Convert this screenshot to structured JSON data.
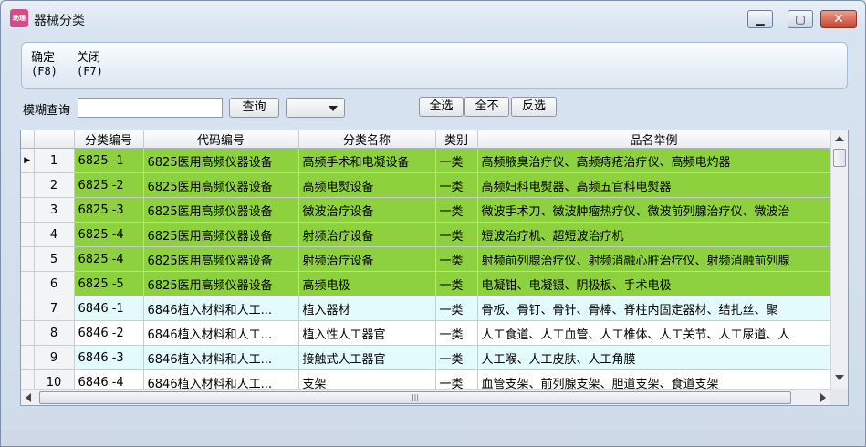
{
  "window": {
    "title": "器械分类",
    "app_icon_text": "助理"
  },
  "toolbar": {
    "confirm": {
      "label": "确定",
      "key": "(F8)"
    },
    "close": {
      "label": "关闭",
      "key": "(F7)"
    }
  },
  "search": {
    "label": "模糊查询",
    "value": "",
    "query_button": "查询",
    "dropdown_value": ""
  },
  "selection": {
    "select_all": "全选",
    "select_none": "全不",
    "invert": "反选"
  },
  "table": {
    "columns": [
      "分类编号",
      "代码编号",
      "分类名称",
      "类别",
      "品名举例"
    ],
    "rows": [
      {
        "n": "1",
        "code": "6825 -1",
        "dcode": "6825医用高频仪器设备",
        "name": "高频手术和电凝设备",
        "cls": "一类",
        "ex": "高频腋臭治疗仪、高频痔疮治疗仪、高频电灼器",
        "style": "green",
        "cur": true
      },
      {
        "n": "2",
        "code": "6825 -2",
        "dcode": "6825医用高频仪器设备",
        "name": "高频电熨设备",
        "cls": "一类",
        "ex": "高频妇科电熨器、高频五官科电熨器",
        "style": "green",
        "cur": false
      },
      {
        "n": "3",
        "code": "6825 -3",
        "dcode": "6825医用高频仪器设备",
        "name": "微波治疗设备",
        "cls": "一类",
        "ex": "微波手术刀、微波肿瘤热疗仪、微波前列腺治疗仪、微波治",
        "style": "green",
        "cur": false
      },
      {
        "n": "4",
        "code": "6825 -4",
        "dcode": "6825医用高频仪器设备",
        "name": "射频治疗设备",
        "cls": "一类",
        "ex": "短波治疗机、超短波治疗机",
        "style": "green",
        "cur": false
      },
      {
        "n": "5",
        "code": "6825 -4",
        "dcode": "6825医用高频仪器设备",
        "name": "射频治疗设备",
        "cls": "一类",
        "ex": "射频前列腺治疗仪、射频消融心脏治疗仪、射频消融前列腺",
        "style": "green",
        "cur": false
      },
      {
        "n": "6",
        "code": "6825 -5",
        "dcode": "6825医用高频仪器设备",
        "name": "高频电极",
        "cls": "一类",
        "ex": " 电凝钳、电凝镊、阴极板、手术电极",
        "style": "green",
        "cur": false
      },
      {
        "n": "7",
        "code": "6846 -1",
        "dcode": "6846植入材料和人工...",
        "name": "植入器材",
        "cls": "一类",
        "ex": "骨板、骨钉、骨针、骨棒、脊柱内固定器材、结扎丝、聚",
        "style": "cyan",
        "cur": false
      },
      {
        "n": "8",
        "code": "6846 -2",
        "dcode": "6846植入材料和人工...",
        "name": "植入性人工器官",
        "cls": "一类",
        "ex": "人工食道、人工血管、人工椎体、人工关节、人工尿道、人",
        "style": "white",
        "cur": false
      },
      {
        "n": "9",
        "code": "6846 -3",
        "dcode": "6846植入材料和人工...",
        "name": "接触式人工器官",
        "cls": "一类",
        "ex": "人工喉、人工皮肤、人工角膜",
        "style": "cyan",
        "cur": false
      },
      {
        "n": "10",
        "code": "6846 -4",
        "dcode": "6846植入材料和人工...",
        "name": "支架",
        "cls": "一类",
        "ex": "血管支架、前列腺支架、胆道支架、食道支架",
        "style": "white",
        "cur": false
      }
    ]
  },
  "icons": {
    "minimize": "minimize-icon",
    "maximize": "maximize-icon",
    "close": "close-icon",
    "row_pointer": "row-pointer-icon",
    "dropdown": "chevron-down-icon"
  }
}
